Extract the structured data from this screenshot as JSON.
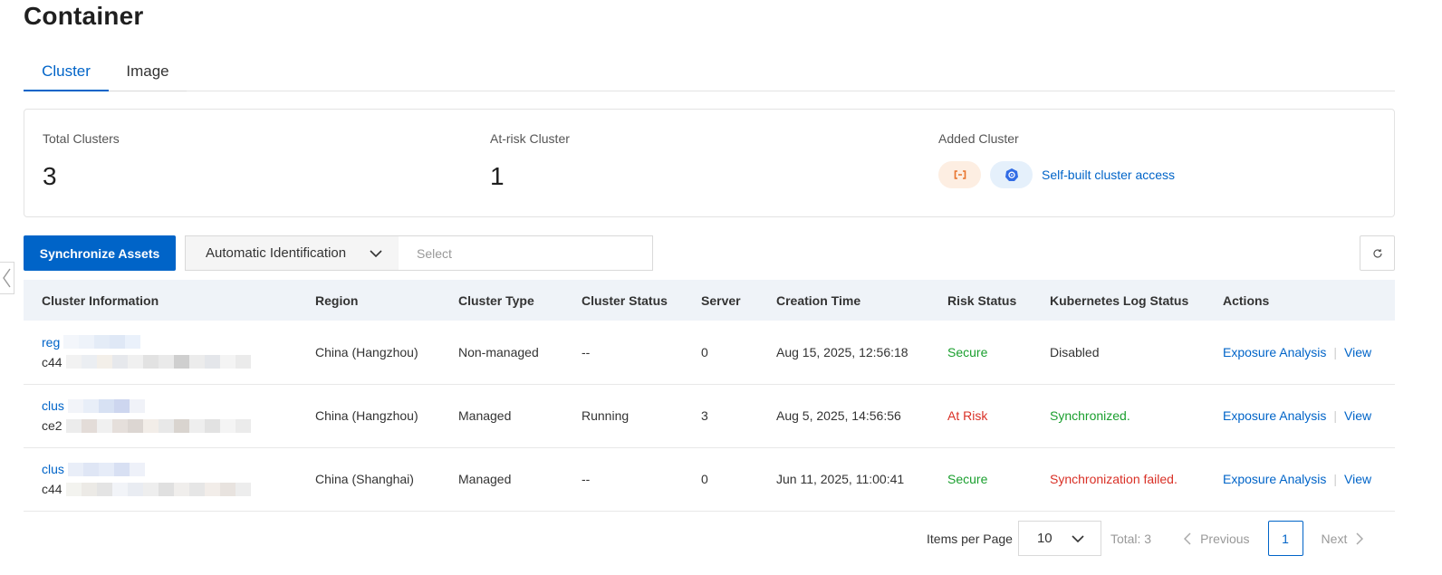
{
  "page_title": "Container",
  "tabs": [
    {
      "label": "Cluster",
      "active": true
    },
    {
      "label": "Image",
      "active": false
    }
  ],
  "summary": {
    "total_label": "Total Clusters",
    "total_value": "3",
    "atrisk_label": "At-risk Cluster",
    "atrisk_value": "1",
    "added_label": "Added Cluster",
    "self_built_link": "Self-built cluster access"
  },
  "toolbar": {
    "sync_label": "Synchronize Assets",
    "filter_mode": "Automatic Identification",
    "filter_placeholder": "Select"
  },
  "table": {
    "headers": [
      "Cluster Information",
      "Region",
      "Cluster Type",
      "Cluster Status",
      "Server",
      "Creation Time",
      "Risk Status",
      "Kubernetes Log Status",
      "Actions"
    ],
    "rows": [
      {
        "name": "reg",
        "id": "c44",
        "region": "China (Hangzhou)",
        "type": "Non-managed",
        "status": "--",
        "server": "0",
        "created": "Aug 15, 2025, 12:56:18",
        "risk": "Secure",
        "log": "Disabled"
      },
      {
        "name": "clus",
        "id": "ce2",
        "region": "China (Hangzhou)",
        "type": "Managed",
        "status": "Running",
        "server": "3",
        "created": "Aug 5, 2025, 14:56:56",
        "risk": "At Risk",
        "log": "Synchronized."
      },
      {
        "name": "clus",
        "id": "c44",
        "region": "China (Shanghai)",
        "type": "Managed",
        "status": "--",
        "server": "0",
        "created": "Jun 11, 2025, 11:00:41",
        "risk": "Secure",
        "log": "Synchronization failed."
      }
    ],
    "action_exposure": "Exposure Analysis",
    "action_view": "View"
  },
  "pagination": {
    "items_per_page_label": "Items per Page",
    "items_per_page": "10",
    "total": "Total: 3",
    "previous": "Previous",
    "current_page": "1",
    "next": "Next"
  },
  "colors": {
    "primary": "#0064c8",
    "secure": "#1a9f2e",
    "danger": "#d93026"
  },
  "icons": [
    "orange-link-icon",
    "kubernetes-icon",
    "chevron-down-icon",
    "refresh-icon",
    "chevron-left-icon",
    "chevron-right-icon"
  ]
}
